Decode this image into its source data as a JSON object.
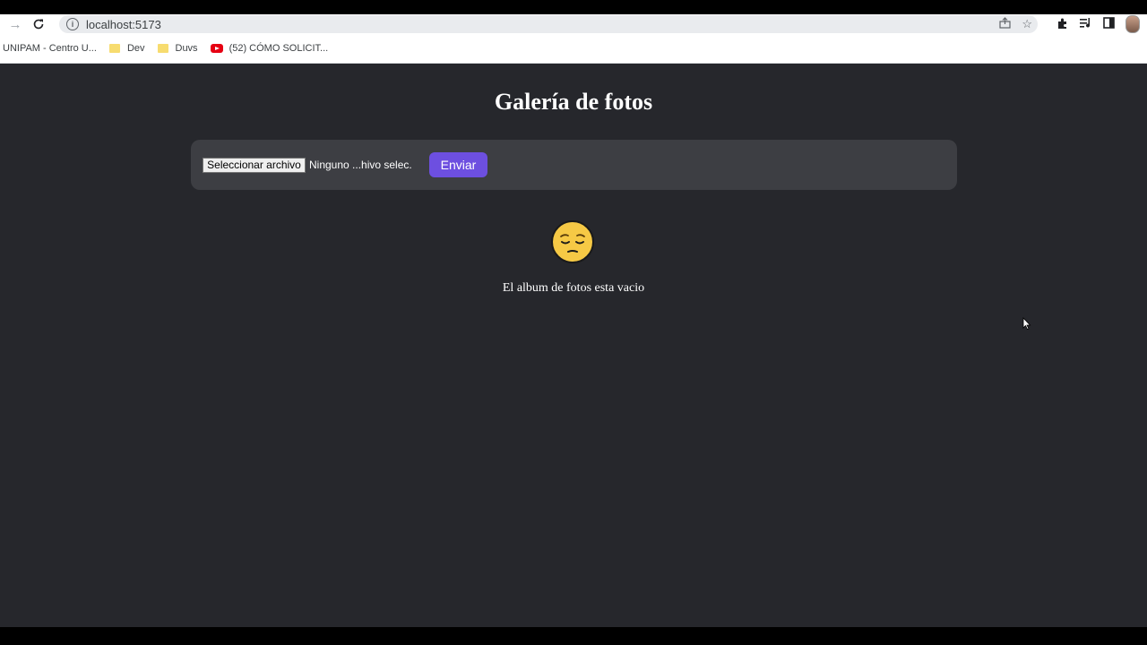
{
  "browser": {
    "url": "localhost:5173",
    "icons": [
      "back-arrow-icon",
      "reload-icon",
      "info-icon",
      "share-icon",
      "star-icon",
      "extensions-icon",
      "media-queue-icon",
      "side-panel-icon",
      "profile-avatar"
    ],
    "bookmarks": [
      {
        "label": "UNIPAM - Centro U...",
        "icon": "none"
      },
      {
        "label": "Dev",
        "icon": "folder-icon"
      },
      {
        "label": "Duvs",
        "icon": "folder-icon"
      },
      {
        "label": "(52) CÓMO SOLICIT...",
        "icon": "youtube-icon"
      }
    ]
  },
  "page": {
    "title": "Galería de fotos",
    "upload": {
      "file_button_label": "Seleccionar archivo",
      "file_status": "Ninguno ...hivo selec.",
      "submit_label": "Enviar"
    },
    "empty_state": {
      "icon": "pensive-face-icon",
      "message": "El album de fotos esta vacio"
    }
  },
  "colors": {
    "page_background": "#26272c",
    "panel_background": "#3d3e43",
    "accent": "#6d4fe0",
    "face": "#f6c945"
  }
}
